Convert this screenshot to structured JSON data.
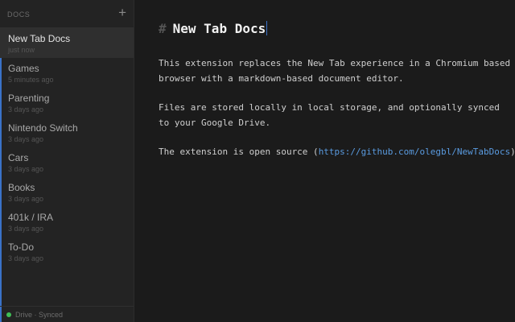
{
  "sidebar": {
    "title": "DOCS",
    "add_glyph": "+",
    "add_icon": "plus-icon",
    "accent_color": "#3a72c8",
    "items": [
      {
        "title": "New Tab Docs",
        "time": "just now",
        "active": true
      },
      {
        "title": "Games",
        "time": "5 minutes ago"
      },
      {
        "title": "Parenting",
        "time": "3 days ago"
      },
      {
        "title": "Nintendo Switch",
        "time": "3 days ago"
      },
      {
        "title": "Cars",
        "time": "3 days ago"
      },
      {
        "title": "Books",
        "time": "3 days ago"
      },
      {
        "title": "401k / IRA",
        "time": "3 days ago"
      },
      {
        "title": "To-Do",
        "time": "3 days ago"
      }
    ],
    "footer": {
      "status_text": "Drive · Synced",
      "status_color": "#3fbf56"
    }
  },
  "editor": {
    "heading_marker": "#",
    "heading": "New Tab Docs",
    "paragraphs": {
      "p1_line1": "This extension replaces the New Tab experience in a Chromium based",
      "p1_line2": "browser with a markdown-based document editor.",
      "p2_line1": "Files are stored locally in local storage, and optionally synced",
      "p2_line2": "to your Google Drive.",
      "p3_prefix": "The extension is open source (",
      "p3_link": "https://github.com/olegbl/NewTabDocs",
      "p3_suffix": ")."
    }
  }
}
